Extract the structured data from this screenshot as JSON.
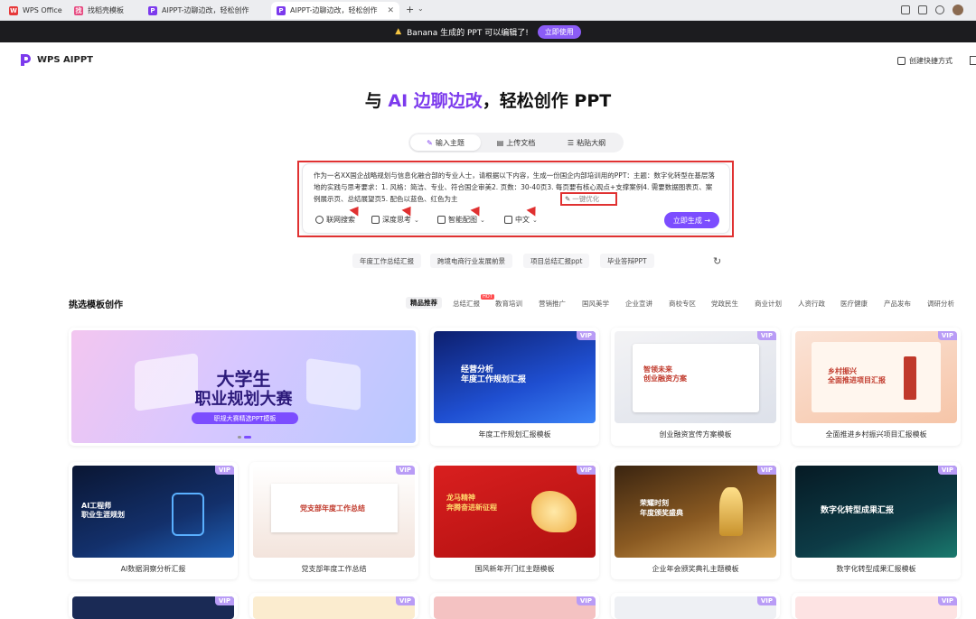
{
  "browser": {
    "tabs": [
      "WPS Office",
      "找稻壳模板",
      "AIPPT-边聊边改，轻松创作",
      "AIPPT-边聊边改，轻松创作"
    ],
    "new_tab": "+"
  },
  "banner": {
    "text": "Banana 生成的 PPT 可以编辑了!",
    "button": "立即使用"
  },
  "header": {
    "logo": "WPS AIPPT",
    "shortcut": "创建快捷方式"
  },
  "hero": {
    "prefix": "与 ",
    "ai": "AI 边聊边改",
    "suffix": "，轻松创作 PPT"
  },
  "modes": [
    "输入主题",
    "上传文档",
    "粘贴大纲"
  ],
  "composer": {
    "prompt": "作为一名XX国企战略规划与信息化融合部的专业人士，请根据以下内容，生成一份国企内部培训用的PPT：主题：数字化转型在基层落地的实践与思考要求：1. 风格：简洁、专业、符合国企审美2. 页数：30-40页3. 每页要有核心观点+支撑案例4. 需要数据图表页、案例展示页、总结展望页5. 配色以蓝色、红色为主",
    "optimize": "一键优化",
    "tools": [
      "联网搜索",
      "深度思考",
      "智能配图",
      "中文"
    ],
    "generate": "立即生成 →"
  },
  "suggestions": [
    "年度工作总结汇报",
    "跨境电商行业发展前景",
    "项目总结汇报ppt",
    "毕业答辩PPT"
  ],
  "templates": {
    "title": "挑选模板创作",
    "categories": [
      "精品推荐",
      "总结汇报",
      "教育培训",
      "营销推广",
      "国风美学",
      "企业宣讲",
      "商校专区",
      "党政民生",
      "商业计划",
      "人资行政",
      "医疗健康",
      "产品发布",
      "调研分析"
    ],
    "hot": "HOT",
    "featured": {
      "line1": "大学生",
      "line2": "职业规划大赛",
      "tag": "职规大赛精选PPT模板"
    },
    "row1": [
      {
        "caption": "年度工作规划汇报模板",
        "title": "经营分析\n年度工作规划汇报"
      },
      {
        "caption": "创业融资宣传方案模板",
        "title": "智领未来\n创业融资方案"
      },
      {
        "caption": "全面推进乡村振兴项目汇报模板",
        "title": "乡村振兴\n全面推进项目汇报"
      }
    ],
    "row2": [
      {
        "caption": "AI数据洞察分析汇报",
        "title": "AI工程师\n职业生涯规划"
      },
      {
        "caption": "党支部年度工作总结",
        "title": "党支部年度工作总结"
      },
      {
        "caption": "国风新年开门红主题模板",
        "title": "龙马精神\n奔腾奋进新征程"
      },
      {
        "caption": "企业年会颁奖典礼主题模板",
        "title": "荣耀时刻\n年度颁奖盛典"
      },
      {
        "caption": "数字化转型成果汇报模板",
        "title": "数字化转型成果汇报"
      }
    ],
    "vip": "VIP"
  },
  "colors": {
    "accent": "#7c4dff",
    "annotation": "#e03131"
  }
}
